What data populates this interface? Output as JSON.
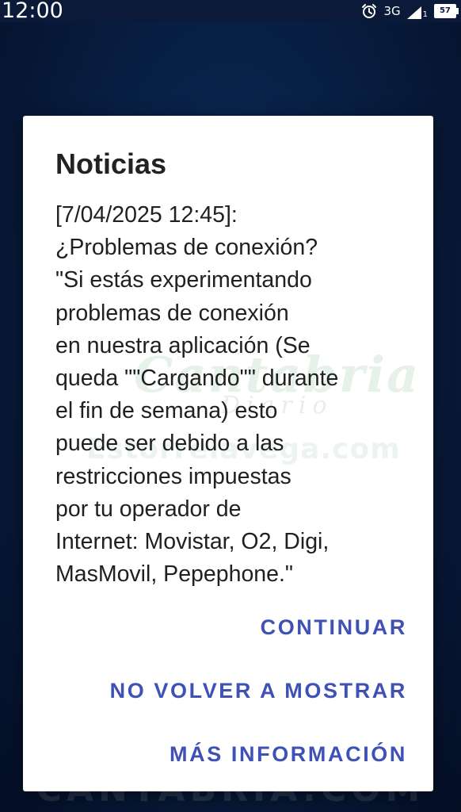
{
  "status_bar": {
    "time": "12:00",
    "network": "3G",
    "sim_slot": "1",
    "battery_level": "57",
    "icons": [
      "alarm-icon",
      "signal-icon",
      "battery-icon"
    ]
  },
  "dialog": {
    "title": "Noticias",
    "message_lines": [
      "[7/04/2025 12:45]:",
      "¿Problemas de conexión?",
      "\"Si estás experimentando",
      "problemas de conexión",
      "en nuestra aplicación (Se",
      "queda \"\"Cargando\"\" durante",
      "el fin de semana) esto",
      "puede ser debido a las",
      "restricciones impuestas",
      "por tu operador de",
      "Internet: Movistar, O2, Digi,",
      "MasMovil, Pepephone.\""
    ],
    "buttons": {
      "continue": "CONTINUAR",
      "dont_show": "NO VOLVER A MOSTRAR",
      "more_info": "MÁS INFORMACIÓN"
    },
    "watermark": {
      "logo": "Cantabria",
      "sub": "Diario",
      "site": "Estorrelavega.com"
    }
  },
  "background": {
    "caption": "CANTABRIA.COM"
  },
  "colors": {
    "accent": "#3f51b5",
    "status_bar": "#0b1a38",
    "background": "#081f44",
    "dialog": "#ffffff"
  }
}
